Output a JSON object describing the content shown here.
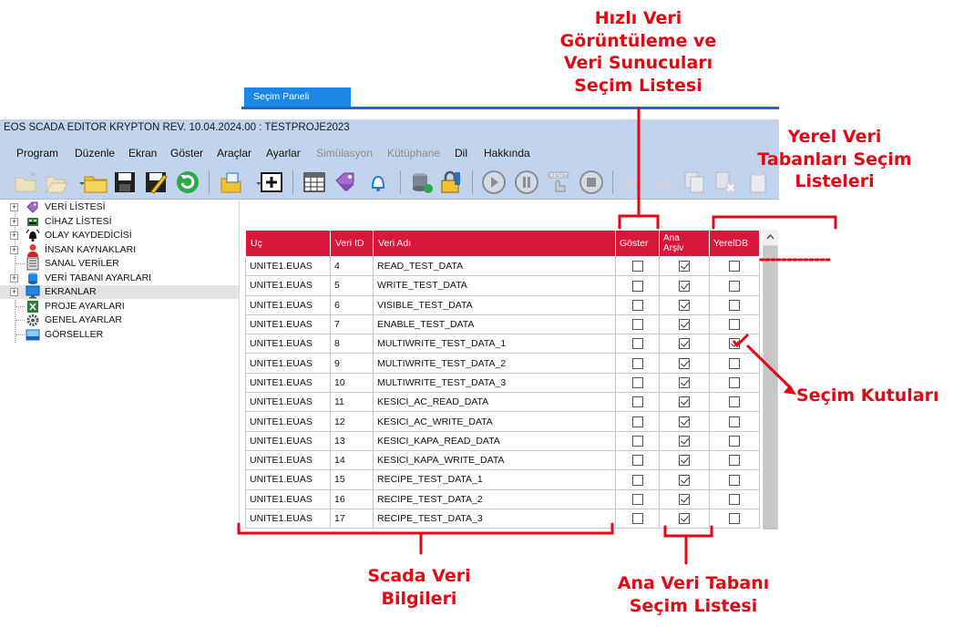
{
  "window": {
    "title": "EOS SCADA EDITOR KRYPTON REV. 10.04.2024.00 : TESTPROJE2023"
  },
  "menu": [
    {
      "label": "Program",
      "disabled": false
    },
    {
      "label": "Düzenle",
      "disabled": false
    },
    {
      "label": "Ekran",
      "disabled": false
    },
    {
      "label": "Göster",
      "disabled": false
    },
    {
      "label": "Araçlar",
      "disabled": false
    },
    {
      "label": "Ayarlar",
      "disabled": false
    },
    {
      "label": "Simülasyon",
      "disabled": true
    },
    {
      "label": "Kütüphane",
      "disabled": true
    },
    {
      "label": "Dil",
      "disabled": false
    },
    {
      "label": "Hakkında",
      "disabled": false
    }
  ],
  "toolbar": {
    "icons": [
      "new-folder-icon",
      "open-folder-icon",
      "folder-icon",
      "save-icon",
      "save-as-icon",
      "refresh-icon",
      "open-screen-icon",
      "add-screen-icon",
      "table-icon",
      "tag-icon",
      "bell-icon",
      "database-icon",
      "lock-icon",
      "play-icon",
      "pause-icon",
      "reset-icon",
      "stop-icon",
      "undo-icon",
      "redo-icon",
      "copy-icon",
      "delete-copy-icon",
      "paste-icon"
    ],
    "reset_label": "RESET"
  },
  "tree": {
    "items": [
      {
        "label": "VERİ LİSTESİ",
        "icon": "tag-icon",
        "expandable": true
      },
      {
        "label": "CİHAZ LİSTESİ",
        "icon": "device-icon",
        "expandable": true
      },
      {
        "label": "OLAY KAYDEDİCİSİ",
        "icon": "alarm-bell-icon",
        "expandable": true
      },
      {
        "label": "İNSAN KAYNAKLARI",
        "icon": "person-icon",
        "expandable": true
      },
      {
        "label": "SANAL VERİLER",
        "icon": "virtual-data-icon",
        "expandable": false
      },
      {
        "label": "VERİ TABANI AYARLARI",
        "icon": "database-icon",
        "expandable": true
      },
      {
        "label": "EKRANLAR",
        "icon": "monitor-icon",
        "expandable": true
      },
      {
        "label": "PROJE AYARLARI",
        "icon": "excel-icon",
        "expandable": false
      },
      {
        "label": "GENEL AYARLAR",
        "icon": "gear-icon",
        "expandable": false
      },
      {
        "label": "GÖRSELLER",
        "icon": "image-icon",
        "expandable": false
      }
    ],
    "selected_index": 6
  },
  "panel": {
    "tab_label": "Seçim Paneli",
    "columns": {
      "uc": "Uç",
      "veri_id": "Veri ID",
      "veri_adi": "Veri Adı",
      "goster": "Göster",
      "ana_arsiv_1": "Ana",
      "ana_arsiv_2": "Arşiv",
      "yereldb": "YerelDB"
    },
    "rows": [
      {
        "uc": "UNITE1.EUAS",
        "id": "4",
        "name": "READ_TEST_DATA",
        "goster": false,
        "arsiv": true,
        "yerel": false
      },
      {
        "uc": "UNITE1.EUAS",
        "id": "5",
        "name": "WRITE_TEST_DATA",
        "goster": false,
        "arsiv": true,
        "yerel": false
      },
      {
        "uc": "UNITE1.EUAS",
        "id": "6",
        "name": "VISIBLE_TEST_DATA",
        "goster": false,
        "arsiv": true,
        "yerel": false
      },
      {
        "uc": "UNITE1.EUAS",
        "id": "7",
        "name": "ENABLE_TEST_DATA",
        "goster": false,
        "arsiv": true,
        "yerel": false
      },
      {
        "uc": "UNITE1.EUAS",
        "id": "8",
        "name": "MULTIWRITE_TEST_DATA_1",
        "goster": false,
        "arsiv": true,
        "yerel": true
      },
      {
        "uc": "UNITE1.EUAS",
        "id": "9",
        "name": "MULTIWRITE_TEST_DATA_2",
        "goster": false,
        "arsiv": true,
        "yerel": false
      },
      {
        "uc": "UNITE1.EUAS",
        "id": "10",
        "name": "MULTIWRITE_TEST_DATA_3",
        "goster": false,
        "arsiv": true,
        "yerel": false
      },
      {
        "uc": "UNITE1.EUAS",
        "id": "11",
        "name": "KESICI_AC_READ_DATA",
        "goster": false,
        "arsiv": true,
        "yerel": false
      },
      {
        "uc": "UNITE1.EUAS",
        "id": "12",
        "name": "KESICI_AC_WRITE_DATA",
        "goster": false,
        "arsiv": true,
        "yerel": false
      },
      {
        "uc": "UNITE1.EUAS",
        "id": "13",
        "name": "KESICI_KAPA_READ_DATA",
        "goster": false,
        "arsiv": true,
        "yerel": false
      },
      {
        "uc": "UNITE1.EUAS",
        "id": "14",
        "name": "KESICI_KAPA_WRITE_DATA",
        "goster": false,
        "arsiv": true,
        "yerel": false
      },
      {
        "uc": "UNITE1.EUAS",
        "id": "15",
        "name": "RECIPE_TEST_DATA_1",
        "goster": false,
        "arsiv": true,
        "yerel": false
      },
      {
        "uc": "UNITE1.EUAS",
        "id": "16",
        "name": "RECIPE_TEST_DATA_2",
        "goster": false,
        "arsiv": true,
        "yerel": false
      },
      {
        "uc": "UNITE1.EUAS",
        "id": "17",
        "name": "RECIPE_TEST_DATA_3",
        "goster": false,
        "arsiv": true,
        "yerel": false
      }
    ]
  },
  "annotations": {
    "hizli": [
      "Hızlı Veri",
      "Görüntüleme ve",
      "Veri Sunucuları",
      "Seçim Listesi"
    ],
    "yerel": [
      "Yerel Veri",
      "Tabanları Seçim",
      "Listeleri"
    ],
    "kutular": [
      "Seçim Kutuları"
    ],
    "scada": [
      "Scada Veri",
      "Bilgileri"
    ],
    "ana": [
      "Ana Veri Tabanı",
      "Seçim Listesi"
    ]
  },
  "colors": {
    "annotation": "#e30613",
    "header_bg": "#d8183a",
    "tab_bg": "#1c87e6",
    "chrome_bg": "#c2d3ee"
  }
}
